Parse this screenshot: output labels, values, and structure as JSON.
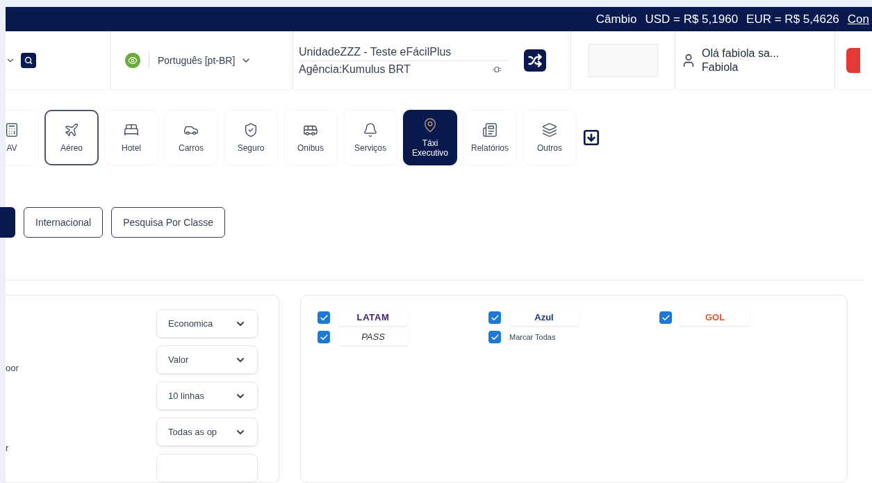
{
  "top_bar": {
    "label": "Câmbio",
    "rates": [
      "USD = R$ 5,1960",
      "EUR = R$ 5,4626"
    ],
    "link": "Con"
  },
  "header": {
    "language": "Português [pt-BR]",
    "unit": "UnidadeZZZ - Teste eFácilPlus",
    "agency": "Agência:Kumulus BRT",
    "greeting": "Olá fabiola sa...",
    "user": "Fabiola"
  },
  "nav": [
    {
      "kind": "rav",
      "label": "AV",
      "selected": false,
      "highlighted": false
    },
    {
      "kind": "plane",
      "label": "Aéreo",
      "selected": true,
      "highlighted": false
    },
    {
      "kind": "hotel",
      "label": "Hotel",
      "selected": false,
      "highlighted": false
    },
    {
      "kind": "car",
      "label": "Carros",
      "selected": false,
      "highlighted": false
    },
    {
      "kind": "shield",
      "label": "Seguro",
      "selected": false,
      "highlighted": false
    },
    {
      "kind": "bus",
      "label": "Onibus",
      "selected": false,
      "highlighted": false
    },
    {
      "kind": "bell",
      "label": "Serviços",
      "selected": false,
      "highlighted": false
    },
    {
      "kind": "pins",
      "label": "Táxi Executivo",
      "selected": false,
      "highlighted": true
    },
    {
      "kind": "report",
      "label": "Relatórios",
      "selected": false,
      "highlighted": false
    },
    {
      "kind": "stack",
      "label": "Outros",
      "selected": false,
      "highlighted": false
    }
  ],
  "search_types": [
    {
      "selected": true
    },
    {
      "label": "Internacional",
      "selected": false
    },
    {
      "label": "Pesquisa Por Classe",
      "selected": false
    }
  ],
  "filters": {
    "labels": [
      "oor",
      "r"
    ],
    "selects": [
      "Economica",
      "Valor",
      "10 linhas",
      "Todas as op"
    ]
  },
  "airlines": [
    {
      "kind": "latam",
      "name": "LATAM",
      "checked": true
    },
    {
      "kind": "azul",
      "name": "Azul",
      "checked": true
    },
    {
      "kind": "gol",
      "name": "GOL",
      "checked": true
    },
    {
      "kind": "voepass",
      "name": "PASS",
      "checked": true
    },
    {
      "kind": "all",
      "name": "Marcar Todas",
      "checked": true
    }
  ]
}
